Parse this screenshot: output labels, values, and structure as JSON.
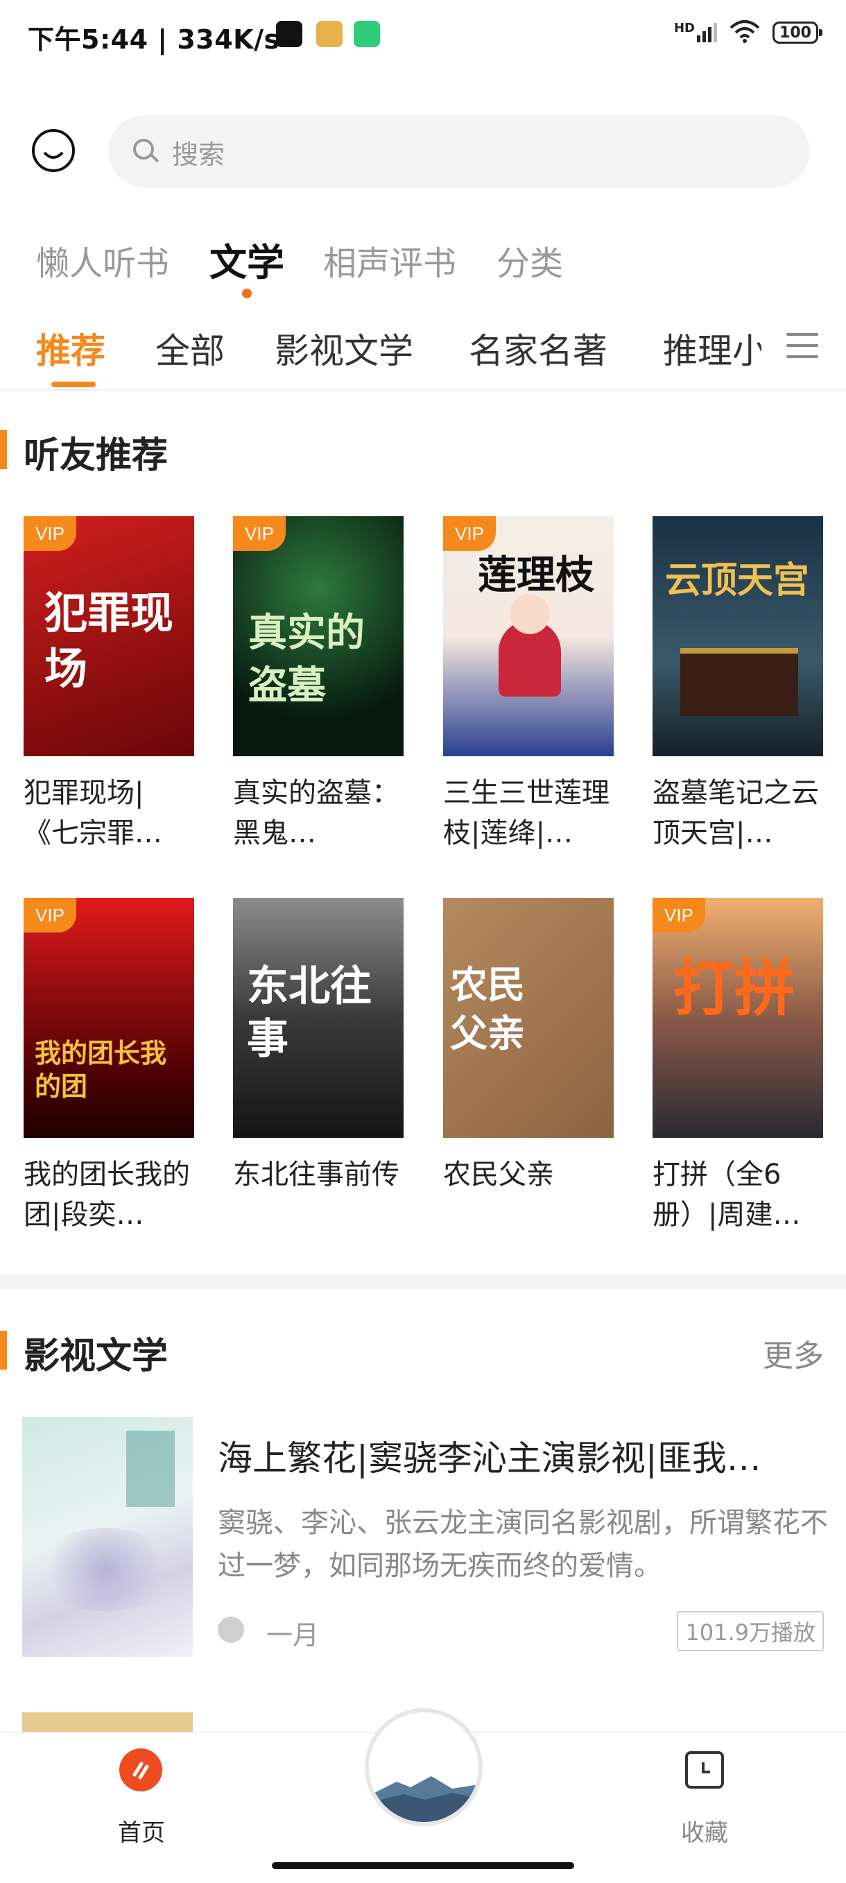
{
  "status_bar": {
    "time": "下午5:44 | 334K/s",
    "network": "HD",
    "battery": "100"
  },
  "search": {
    "placeholder": "搜索"
  },
  "top_tabs": [
    {
      "label": "懒人听书",
      "active": false
    },
    {
      "label": "文学",
      "active": true
    },
    {
      "label": "相声评书",
      "active": false
    },
    {
      "label": "分类",
      "active": false
    }
  ],
  "sub_tabs": [
    {
      "label": "推荐",
      "active": true
    },
    {
      "label": "全部",
      "active": false
    },
    {
      "label": "影视文学",
      "active": false
    },
    {
      "label": "名家名著",
      "active": false
    },
    {
      "label": "推理小",
      "active": false
    }
  ],
  "section_recommend": {
    "title": "听友推荐",
    "books": [
      {
        "title": "犯罪现场|《七宗罪…",
        "vip": true,
        "cover_text": "犯罪现场",
        "cover_color": "#b01818"
      },
      {
        "title": "真实的盗墓：黑鬼…",
        "vip": true,
        "cover_text": "真实的盗墓",
        "cover_color": "#0f3a26"
      },
      {
        "title": "三生三世莲理枝|莲绛|…",
        "vip": true,
        "cover_text": "莲理枝",
        "cover_color": "#2b3f8f"
      },
      {
        "title": "盗墓笔记之云顶天宫|…",
        "vip": false,
        "cover_text": "云顶天宫",
        "cover_color": "#1d3a52"
      },
      {
        "title": "我的团长我的团|段奕…",
        "vip": true,
        "cover_text": "我的团长我的团",
        "cover_color": "#7a0a0a"
      },
      {
        "title": "东北往事前传",
        "vip": false,
        "cover_text": "东北往事",
        "cover_color": "#2a2a2a"
      },
      {
        "title": "农民父亲",
        "vip": false,
        "cover_text": "农民父亲",
        "cover_color": "#a07850"
      },
      {
        "title": "打拼（全6册）|周建…",
        "vip": true,
        "cover_text": "打拼",
        "cover_color": "#6b4a3a"
      }
    ],
    "vip_label": "VIP"
  },
  "section_film": {
    "title": "影视文学",
    "more": "更多",
    "item": {
      "title": "海上繁花|窦骁李沁主演影视|匪我…",
      "desc": "窦骁、李沁、张云龙主演同名影视剧，所谓繁花不过一梦，如同那场无疾而终的爱情。",
      "author": "一月",
      "plays": "101.9万播放"
    }
  },
  "bottom_nav": {
    "home": "首页",
    "favorites": "收藏"
  }
}
